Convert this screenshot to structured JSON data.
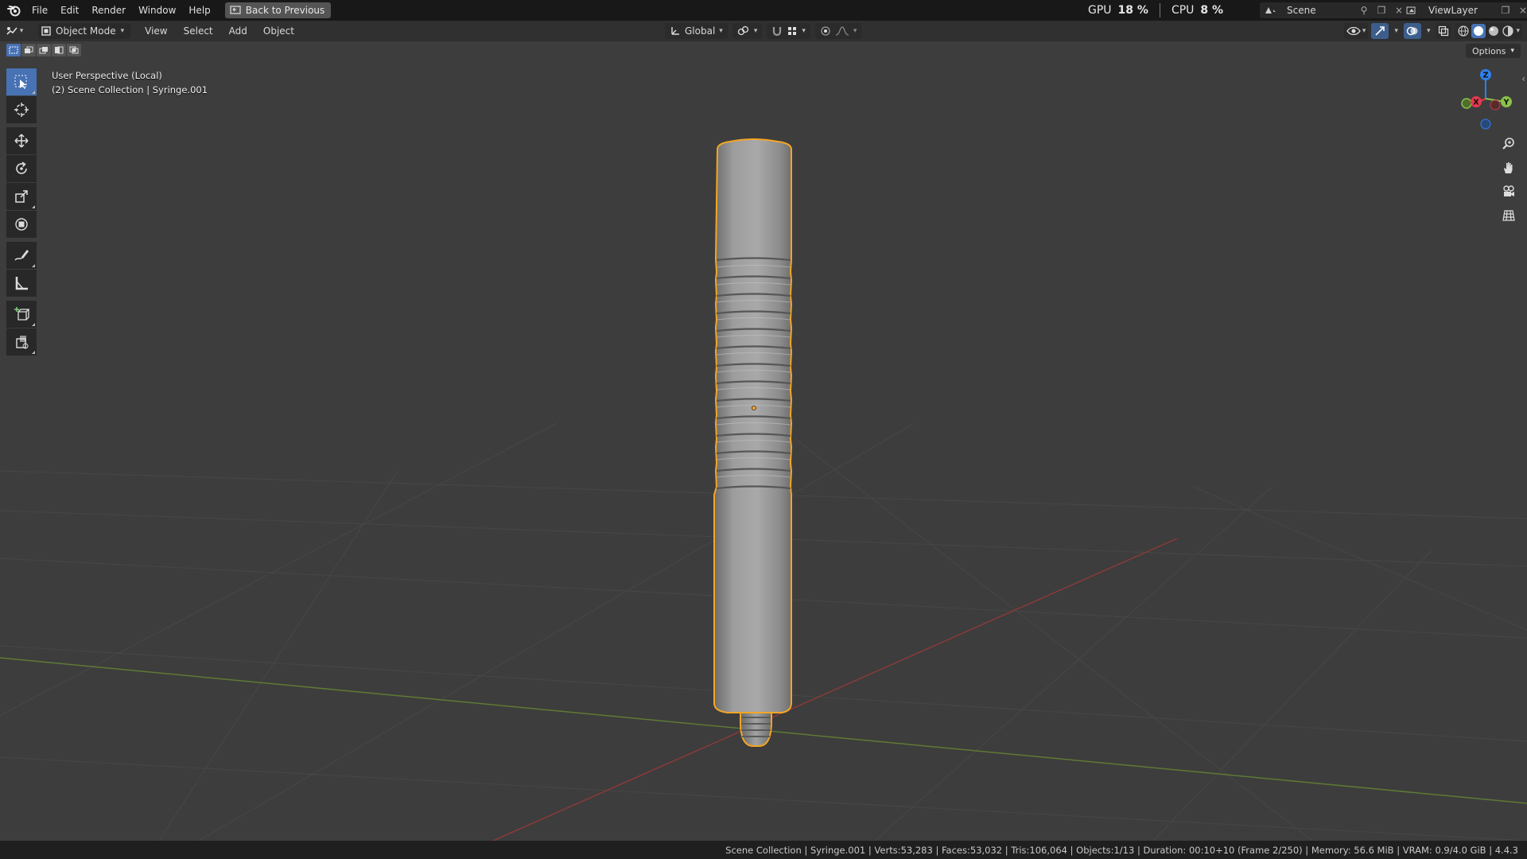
{
  "topbar": {
    "menus": [
      "File",
      "Edit",
      "Render",
      "Window",
      "Help"
    ],
    "back_label": "Back to Previous",
    "gpu_label": "GPU",
    "gpu_value": "18 %",
    "cpu_label": "CPU",
    "cpu_value": "8 %",
    "scene_name": "Scene",
    "view_layer_name": "ViewLayer"
  },
  "header": {
    "mode": "Object Mode",
    "menus": [
      "View",
      "Select",
      "Add",
      "Object"
    ],
    "orientation": "Global",
    "options_label": "Options"
  },
  "viewport": {
    "perspective_text": "User Perspective (Local)",
    "collection_text": "(2) Scene Collection | Syringe.001",
    "gizmo_axes": [
      "Z",
      "X",
      "Y"
    ]
  },
  "toolbar": {
    "tools": [
      "select-box",
      "cursor",
      "move",
      "rotate",
      "scale",
      "transform",
      "annotate",
      "measure",
      "add-cube",
      "add-object"
    ]
  },
  "colors": {
    "accent": "#4772b3",
    "selection_outline": "#f5a623",
    "axis_x": "#e8384f",
    "axis_y": "#8bc34a",
    "axis_z": "#2f80ed"
  },
  "statusbar": {
    "text": "Scene Collection | Syringe.001 | Verts:53,283 | Faces:53,032 | Tris:106,064 | Objects:1/13 | Duration: 00:10+10 (Frame 2/250) | Memory: 56.6 MiB | VRAM: 0.9/4.0 GiB | 4.4.3"
  }
}
